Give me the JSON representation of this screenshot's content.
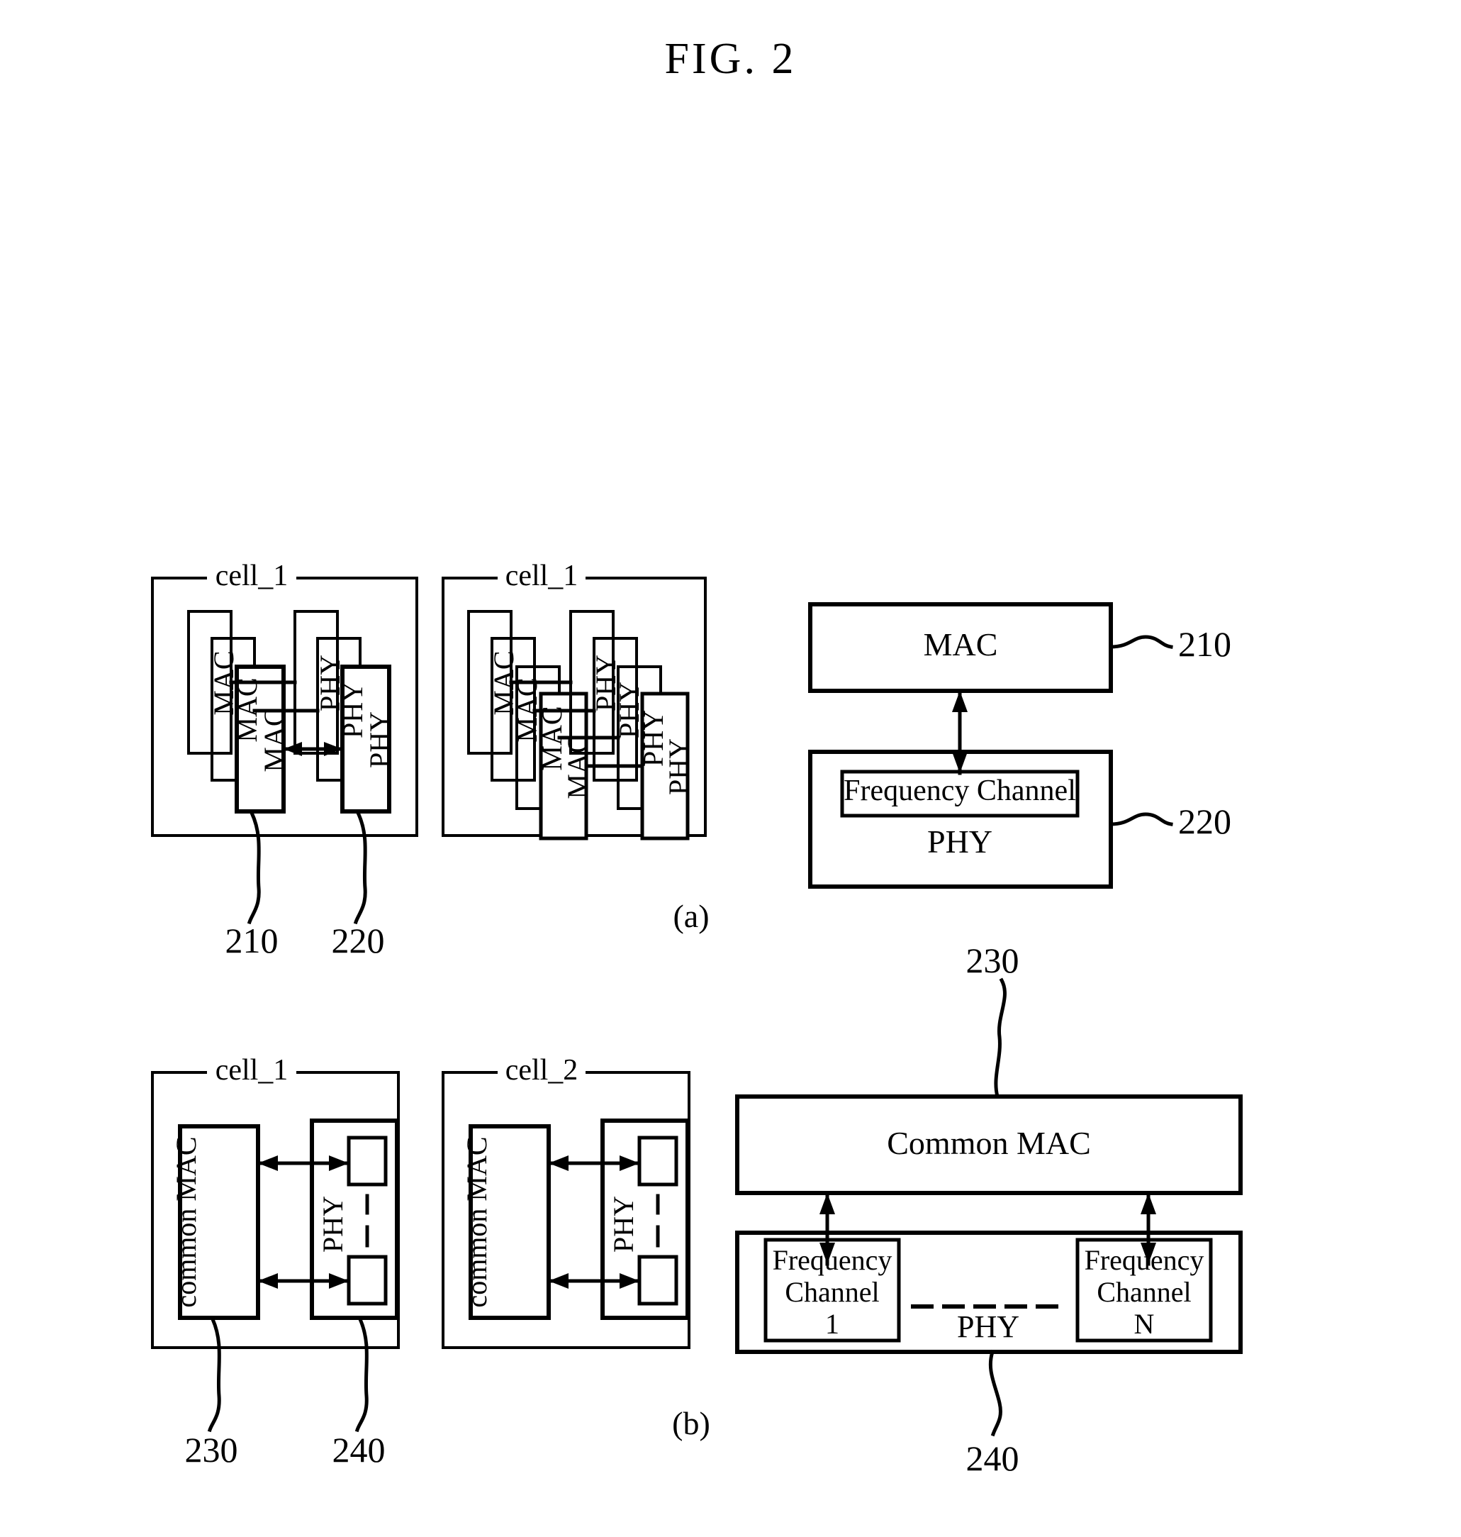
{
  "figure": {
    "title": "FIG. 2",
    "part_labels": {
      "a": "(a)",
      "b": "(b)"
    }
  },
  "part_a": {
    "cell_left": {
      "name": "cell_1",
      "mac_stack": [
        "MAC",
        "MAC",
        "MAC"
      ],
      "phy_stack": [
        "PHY",
        "PHY",
        "PHY"
      ],
      "ref_mac": "210",
      "ref_phy": "220"
    },
    "cell_right": {
      "name": "cell_1",
      "mac_stack": [
        "MAC",
        "MAC",
        "MAC",
        "MAC"
      ],
      "phy_stack": [
        "PHY",
        "PHY",
        "PHY",
        "PHY"
      ]
    },
    "detail": {
      "mac_label": "MAC",
      "mac_ref": "210",
      "phy_label": "PHY",
      "phy_ref": "220",
      "frequency_channel_label": "Frequency Channel"
    }
  },
  "part_b": {
    "cell_left": {
      "name": "cell_1",
      "mac_label": "common MAC",
      "phy_label": "PHY",
      "ref_mac": "230",
      "ref_phy": "240"
    },
    "cell_right": {
      "name": "cell_2",
      "mac_label": "common MAC",
      "phy_label": "PHY"
    },
    "detail": {
      "mac_label": "Common MAC",
      "mac_ref": "230",
      "phy_label": "PHY",
      "phy_ref": "240",
      "channel_first": "Frequency\nChannel\n1",
      "channel_last": "Frequency\nChannel\nN",
      "channel_first_line1": "Frequency",
      "channel_first_line2": "Channel",
      "channel_first_line3": "1",
      "channel_last_line1": "Frequency",
      "channel_last_line2": "Channel",
      "channel_last_line3": "N"
    }
  },
  "colors": {
    "ink": "#000000",
    "paper": "#ffffff"
  }
}
